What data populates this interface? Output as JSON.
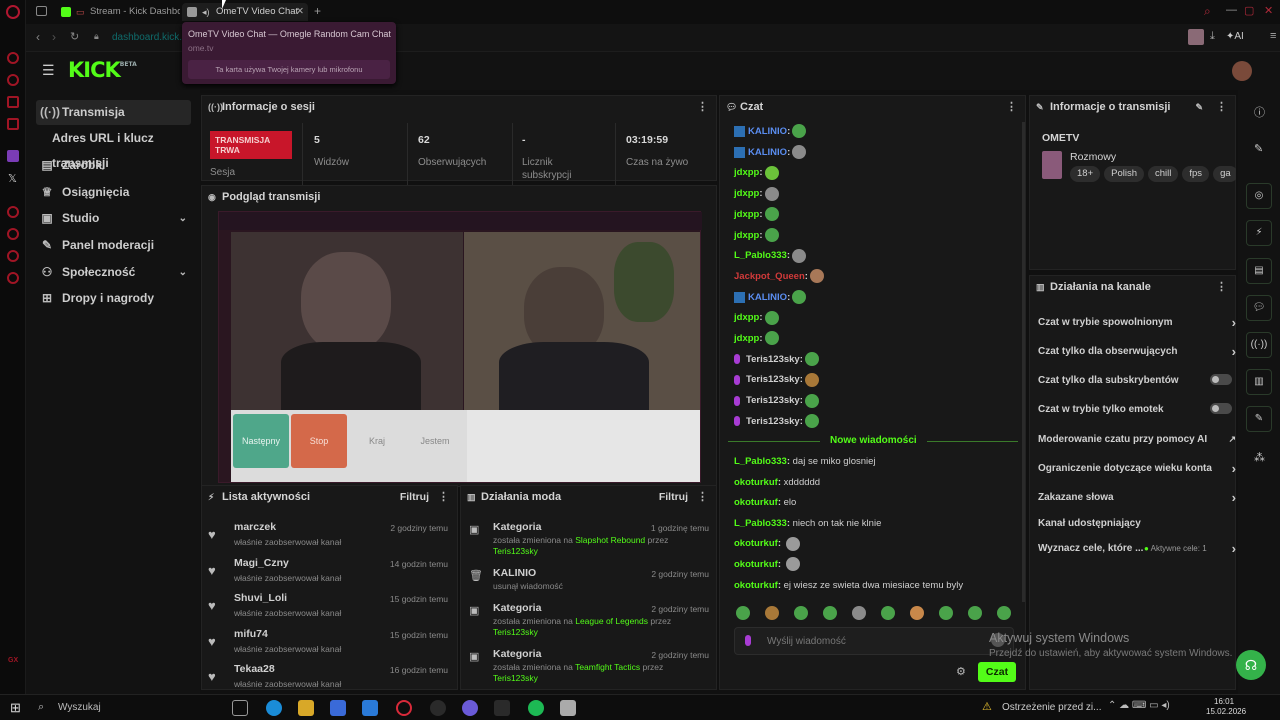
{
  "browser": {
    "tabs": [
      {
        "label": "Stream - Kick Dashboard",
        "active": false
      },
      {
        "label": "OmeTV Video Chat",
        "active": true
      }
    ],
    "url": "dashboard.kick.co",
    "ai_label": "AI",
    "hover_card": {
      "title": "OmeTV Video Chat — Omegle Random Cam Chat ...",
      "domain": "ome.tv",
      "notice": "Ta karta używa Twojej kamery lub mikrofonu"
    }
  },
  "app": {
    "logo": "KICK",
    "logo_sup": "BETA"
  },
  "sidebar": {
    "items": [
      {
        "label": "Transmisja",
        "icon": "broadcast-icon",
        "selected": true
      },
      {
        "label": "Adres URL i klucz transmisji",
        "icon": "",
        "selected": false
      },
      {
        "label": "Zarobki",
        "icon": "wallet-icon",
        "selected": false
      },
      {
        "label": "Osiągnięcia",
        "icon": "trophy-icon",
        "selected": false
      },
      {
        "label": "Studio",
        "icon": "studio-icon",
        "selected": false,
        "expandable": true
      },
      {
        "label": "Panel moderacji",
        "icon": "wrench-icon",
        "selected": false
      },
      {
        "label": "Społeczność",
        "icon": "people-icon",
        "selected": false,
        "expandable": true
      },
      {
        "label": "Dropy i nagrody",
        "icon": "gift-icon",
        "selected": false
      }
    ]
  },
  "session": {
    "title": "Informacje o sesji",
    "live_badge": "TRANSMISJA TRWA",
    "live_label": "Sesja",
    "stats": [
      {
        "value": "5",
        "label": "Widzów"
      },
      {
        "value": "62",
        "label": "Obserwujących"
      },
      {
        "value": "-",
        "label": "Licznik subskrypcji"
      },
      {
        "value": "03:19:59",
        "label": "Czas na żywo"
      }
    ]
  },
  "preview": {
    "title": "Podgląd transmisji",
    "buttons": [
      "Następny",
      "Stop",
      "Kraj",
      "Jestem"
    ]
  },
  "activity": {
    "title": "Lista aktywności",
    "filter": "Filtruj",
    "rows": [
      {
        "name": "marczek",
        "sub": "właśnie zaobserwował kanał",
        "time": "2 godziny temu"
      },
      {
        "name": "Magi_Czny",
        "sub": "właśnie zaobserwował kanał",
        "time": "14 godzin temu"
      },
      {
        "name": "Shuvi_Loli",
        "sub": "właśnie zaobserwował kanał",
        "time": "15 godzin temu"
      },
      {
        "name": "mifu74",
        "sub": "właśnie zaobserwował kanał",
        "time": "15 godzin temu"
      },
      {
        "name": "Tekaa28",
        "sub": "właśnie zaobserwował kanał",
        "time": "16 godzin temu"
      }
    ]
  },
  "mod": {
    "title": "Działania moda",
    "filter": "Filtruj",
    "rows": [
      {
        "name": "Kategoria",
        "pre": "została zmieniona na ",
        "hl": "Slapshot Rebound",
        "mid": " przez ",
        "user": "Teris123sky",
        "time": "1 godzinę temu",
        "icon": "category-icon"
      },
      {
        "name": "KALINIO",
        "pre": "usunął wiadomość",
        "hl": "",
        "mid": "",
        "user": "",
        "time": "2 godziny temu",
        "icon": "trash-icon"
      },
      {
        "name": "Kategoria",
        "pre": "została zmieniona na ",
        "hl": "League of Legends",
        "mid": " przez ",
        "user": "Teris123sky",
        "time": "2 godziny temu",
        "icon": "category-icon"
      },
      {
        "name": "Kategoria",
        "pre": "została zmieniona na ",
        "hl": "Teamfight Tactics",
        "mid": " przez ",
        "user": "Teris123sky",
        "time": "2 godziny temu",
        "icon": "category-icon"
      }
    ]
  },
  "chat": {
    "title": "Czat",
    "messages": [
      {
        "user": "KALINIO",
        "color": "#5a8df0",
        "badge": true,
        "mic": false,
        "text": "",
        "emote": "#4aa34a"
      },
      {
        "user": "KALINIO",
        "color": "#5a8df0",
        "badge": true,
        "mic": false,
        "text": "",
        "emote": "#8a8a8a"
      },
      {
        "user": "jdxpp",
        "color": "#53fc18",
        "badge": false,
        "mic": false,
        "text": "",
        "emote": "#6bc23a"
      },
      {
        "user": "jdxpp",
        "color": "#53fc18",
        "badge": false,
        "mic": false,
        "text": "",
        "emote": "#8a8a8a"
      },
      {
        "user": "jdxpp",
        "color": "#53fc18",
        "badge": false,
        "mic": false,
        "text": "",
        "emote": "#4aa34a"
      },
      {
        "user": "jdxpp",
        "color": "#53fc18",
        "badge": false,
        "mic": false,
        "text": "",
        "emote": "#4aa34a"
      },
      {
        "user": "L_Pablo333",
        "color": "#53fc18",
        "badge": false,
        "mic": false,
        "text": "",
        "emote": "#8a8a8a"
      },
      {
        "user": "Jackpot_Queen",
        "color": "#d23a3a",
        "badge": false,
        "mic": false,
        "text": "",
        "emote": "#a87858"
      },
      {
        "user": "KALINIO",
        "color": "#5a8df0",
        "badge": true,
        "mic": false,
        "text": "",
        "emote": "#4aa34a"
      },
      {
        "user": "jdxpp",
        "color": "#53fc18",
        "badge": false,
        "mic": false,
        "text": "",
        "emote": "#4aa34a"
      },
      {
        "user": "jdxpp",
        "color": "#53fc18",
        "badge": false,
        "mic": false,
        "text": "",
        "emote": "#4aa34a"
      },
      {
        "user": "Teris123sky",
        "color": "#d0d0d0",
        "badge": false,
        "mic": true,
        "text": "",
        "emote": "#4aa34a"
      },
      {
        "user": "Teris123sky",
        "color": "#d0d0d0",
        "badge": false,
        "mic": true,
        "text": "",
        "emote": "#a87838"
      },
      {
        "user": "Teris123sky",
        "color": "#d0d0d0",
        "badge": false,
        "mic": true,
        "text": "",
        "emote": "#4aa34a"
      },
      {
        "user": "Teris123sky",
        "color": "#d0d0d0",
        "badge": false,
        "mic": true,
        "text": "",
        "emote": "#4aa34a"
      }
    ],
    "new_divider": "Nowe wiadomości",
    "new_messages": [
      {
        "user": "L_Pablo333",
        "text": "daj se miko glosniej",
        "emote": ""
      },
      {
        "user": "okoturkuf",
        "text": "xdddddd",
        "emote": ""
      },
      {
        "user": "okoturkuf",
        "text": "elo",
        "emote": ""
      },
      {
        "user": "L_Pablo333",
        "text": "niech on tak nie klnie",
        "emote": ""
      },
      {
        "user": "okoturkuf",
        "text": "",
        "emote": "#9a9a9a"
      },
      {
        "user": "okoturkuf",
        "text": "",
        "emote": "#9a9a9a"
      },
      {
        "user": "okoturkuf",
        "text": "ej wiesz ze swieta dwa miesiace temu byly",
        "emote": ""
      }
    ],
    "input_placeholder": "Wyślij wiadomość",
    "send_label": "Czat"
  },
  "stream_info": {
    "title": "Informacje o transmisji",
    "stream_title": "OMETV",
    "category": "Rozmowy",
    "tags": [
      "18+",
      "Polish",
      "chill",
      "fps",
      "ga"
    ]
  },
  "channel_actions": {
    "title": "Działania na kanale",
    "rows": [
      {
        "label": "Czat w trybie spowolnionym",
        "control": "arrow"
      },
      {
        "label": "Czat tylko dla obserwujących",
        "control": "arrow"
      },
      {
        "label": "Czat tylko dla subskrybentów",
        "control": "toggle"
      },
      {
        "label": "Czat w trybie tylko emotek",
        "control": "toggle"
      },
      {
        "label": "Moderowanie czatu przy pomocy AI",
        "control": "external"
      },
      {
        "label": "Ograniczenie dotyczące wieku konta",
        "control": "arrow"
      },
      {
        "label": "Zakazane słowa",
        "control": "arrow"
      },
      {
        "label": "Kanał udostępniający",
        "control": "none"
      },
      {
        "label": "Wyznacz cele, które ...",
        "control": "goals"
      }
    ],
    "goals_label": "Aktywne cele: 1"
  },
  "watermark": {
    "title": "Aktywuj system Windows",
    "subtitle": "Przejdź do ustawień, aby aktywować system Windows."
  },
  "taskbar": {
    "search": "Wyszukaj",
    "notice": "Ostrzeżenie przed zi...",
    "time": "16:01",
    "date": "15.02.2026"
  }
}
